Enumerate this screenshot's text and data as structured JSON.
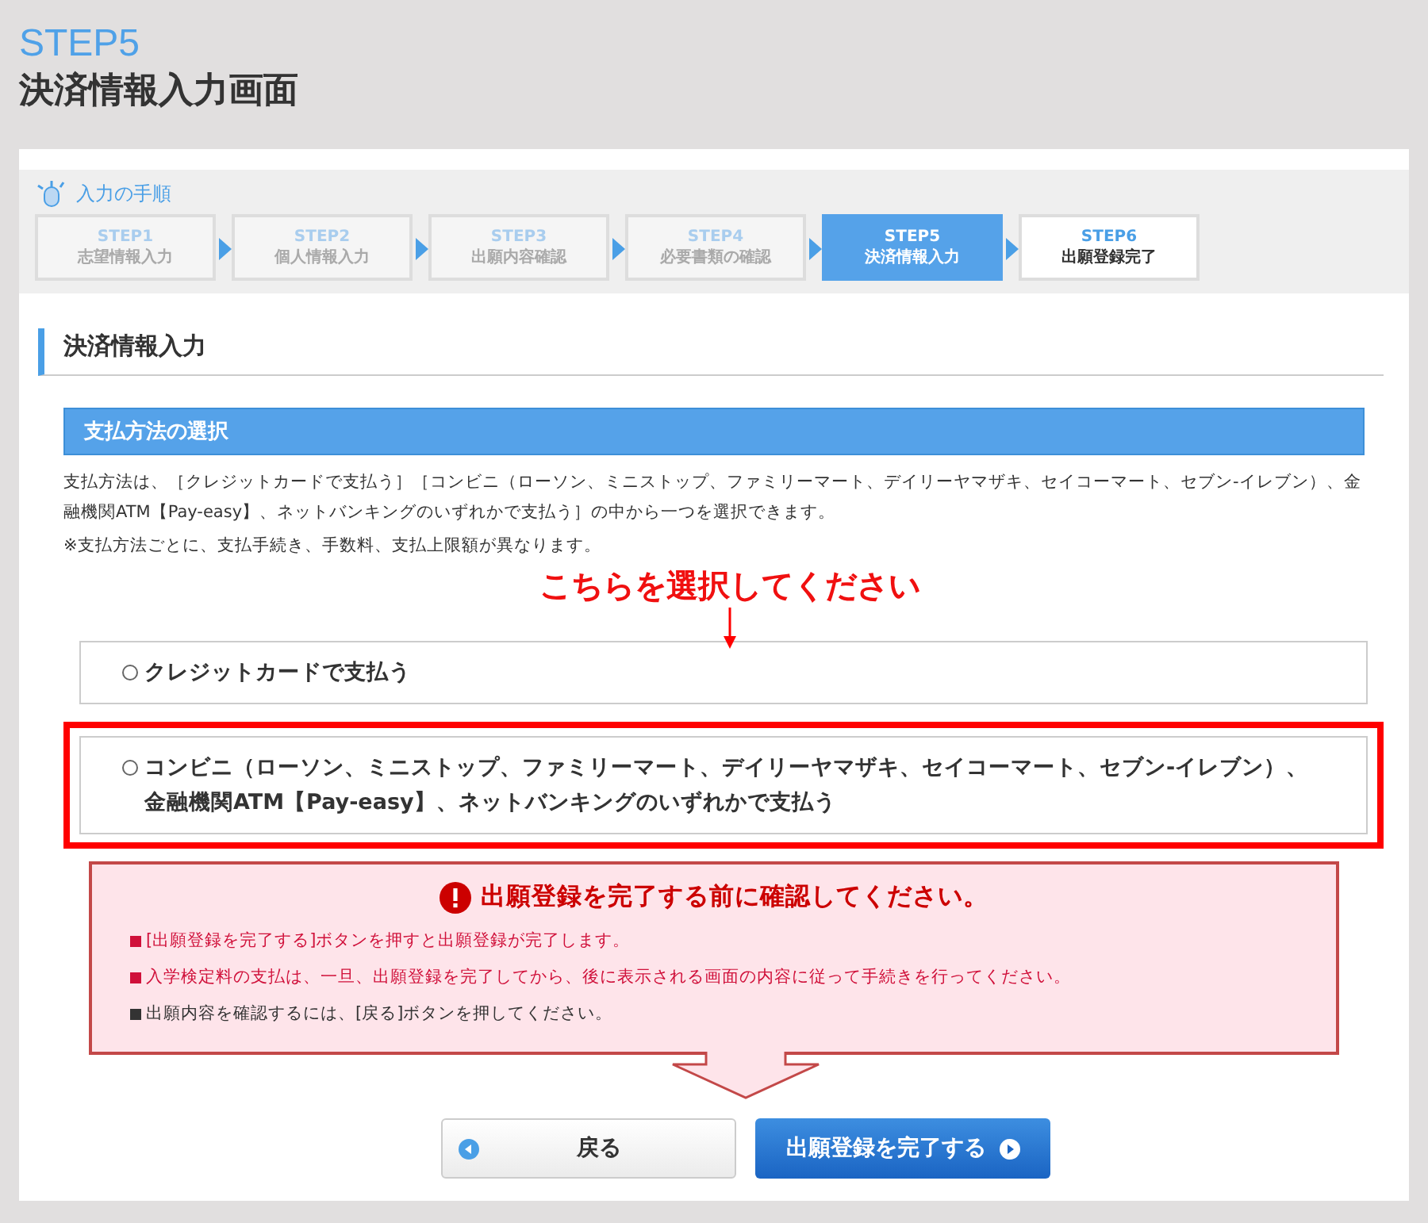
{
  "header": {
    "step": "STEP5",
    "title": "決済情報入力画面"
  },
  "progress": {
    "title": "入力の手順",
    "steps": [
      {
        "step": "STEP1",
        "label": "志望情報入力",
        "selected": false,
        "disabled": true
      },
      {
        "step": "STEP2",
        "label": "個人情報入力",
        "selected": false,
        "disabled": true
      },
      {
        "step": "STEP3",
        "label": "出願内容確認",
        "selected": false,
        "disabled": true
      },
      {
        "step": "STEP4",
        "label": "必要書類の確認",
        "selected": false,
        "disabled": true
      },
      {
        "step": "STEP5",
        "label": "決済情報入力",
        "selected": true,
        "disabled": false
      },
      {
        "step": "STEP6",
        "label": "出願登録完了",
        "selected": false,
        "disabled": false
      }
    ]
  },
  "section": {
    "title": "決済情報入力",
    "subtitle": "支払方法の選択",
    "description": "支払方法は、［クレジットカードで支払う］［コンビニ（ローソン、ミニストップ、ファミリーマート、デイリーヤマザキ、セイコーマート、セブン-イレブン）、金融機関ATM【Pay-easy】、ネットバンキングのいずれかで支払う］の中から一つを選択できます。",
    "note": "※支払方法ごとに、支払手続き、手数料、支払上限額が異なります。",
    "annotation": "こちらを選択してください",
    "options": [
      {
        "label": "クレジットカードで支払う",
        "selected": false,
        "highlighted": false
      },
      {
        "label": "コンビニ（ローソン、ミニストップ、ファミリーマート、デイリーヤマザキ、セイコーマート、セブン-イレブン）、金融機関ATM【Pay-easy】、ネットバンキングのいずれかで支払う",
        "selected": false,
        "highlighted": true
      }
    ]
  },
  "notice": {
    "title": "出願登録を完了する前に確認してください。",
    "items": [
      {
        "text": "[出願登録を完了する]ボタンを押すと出願登録が完了します。",
        "color": "#d0103a"
      },
      {
        "text": "入学検定料の支払は、一旦、出願登録を完了してから、後に表示される画面の内容に従って手続きを行ってください。",
        "color": "#d0103a"
      },
      {
        "text": "出願内容を確認するには、[戻る]ボタンを押してください。",
        "color": "#333333"
      }
    ]
  },
  "buttons": {
    "back": "戻る",
    "submit": "出願登録を完了する"
  }
}
